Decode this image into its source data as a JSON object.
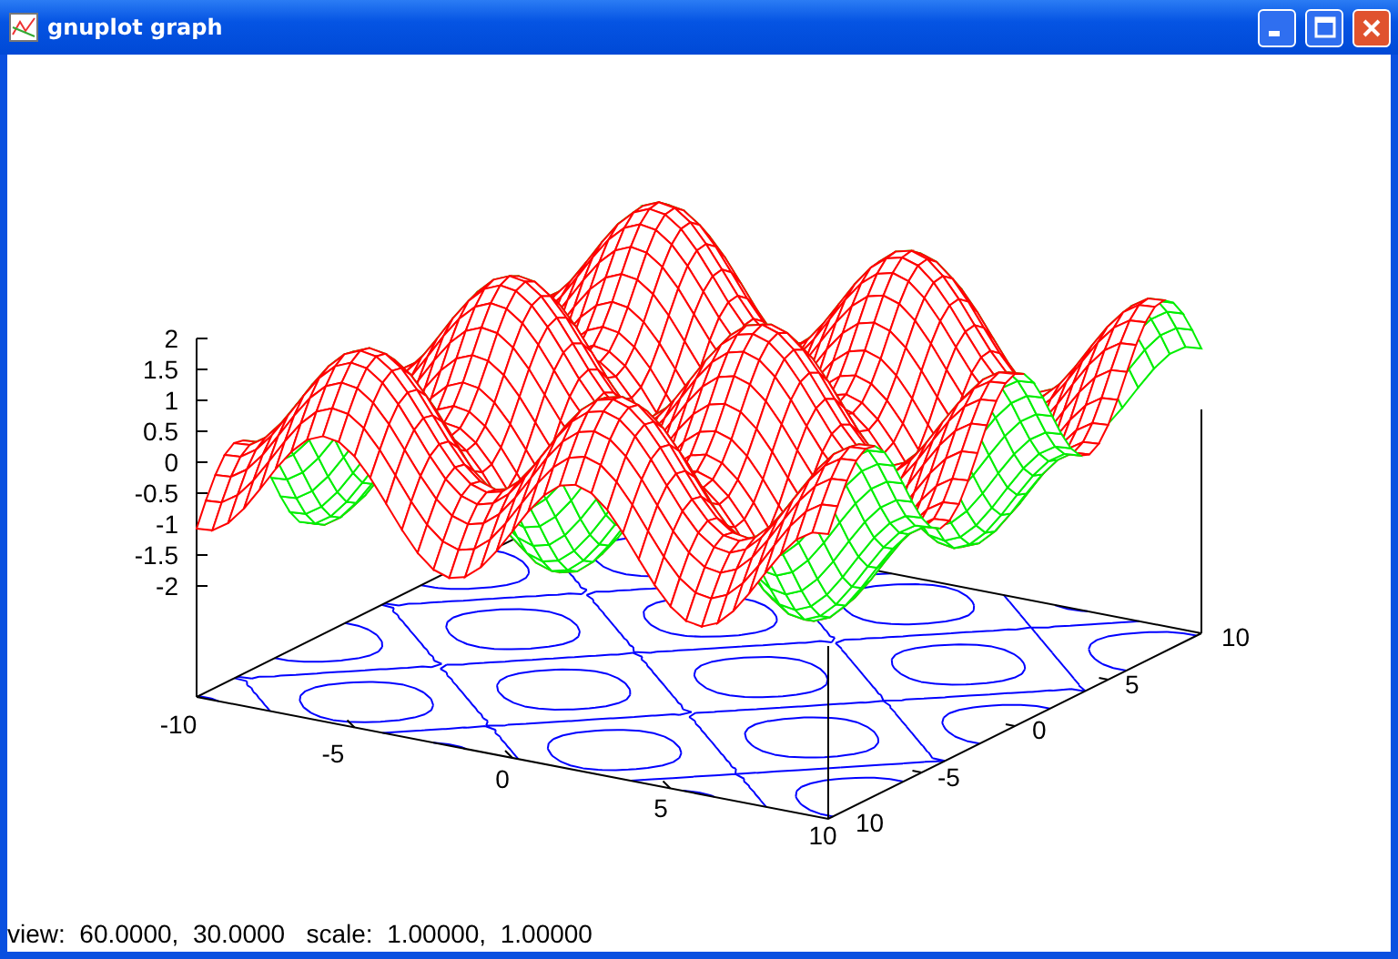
{
  "window": {
    "title": "gnuplot graph"
  },
  "plot": {
    "z_ticks": [
      "2",
      "1.5",
      "1",
      "0.5",
      "0",
      "-0.5",
      "-1",
      "-1.5",
      "-2"
    ],
    "x_ticks": [
      "-10",
      "-5",
      "0",
      "5",
      "10"
    ],
    "y_ticks": [
      "10",
      "-5",
      "0",
      "5",
      "10"
    ]
  },
  "status_bar": {
    "text": "view:  60.0000,  30.0000   scale:  1.00000,  1.00000"
  }
}
